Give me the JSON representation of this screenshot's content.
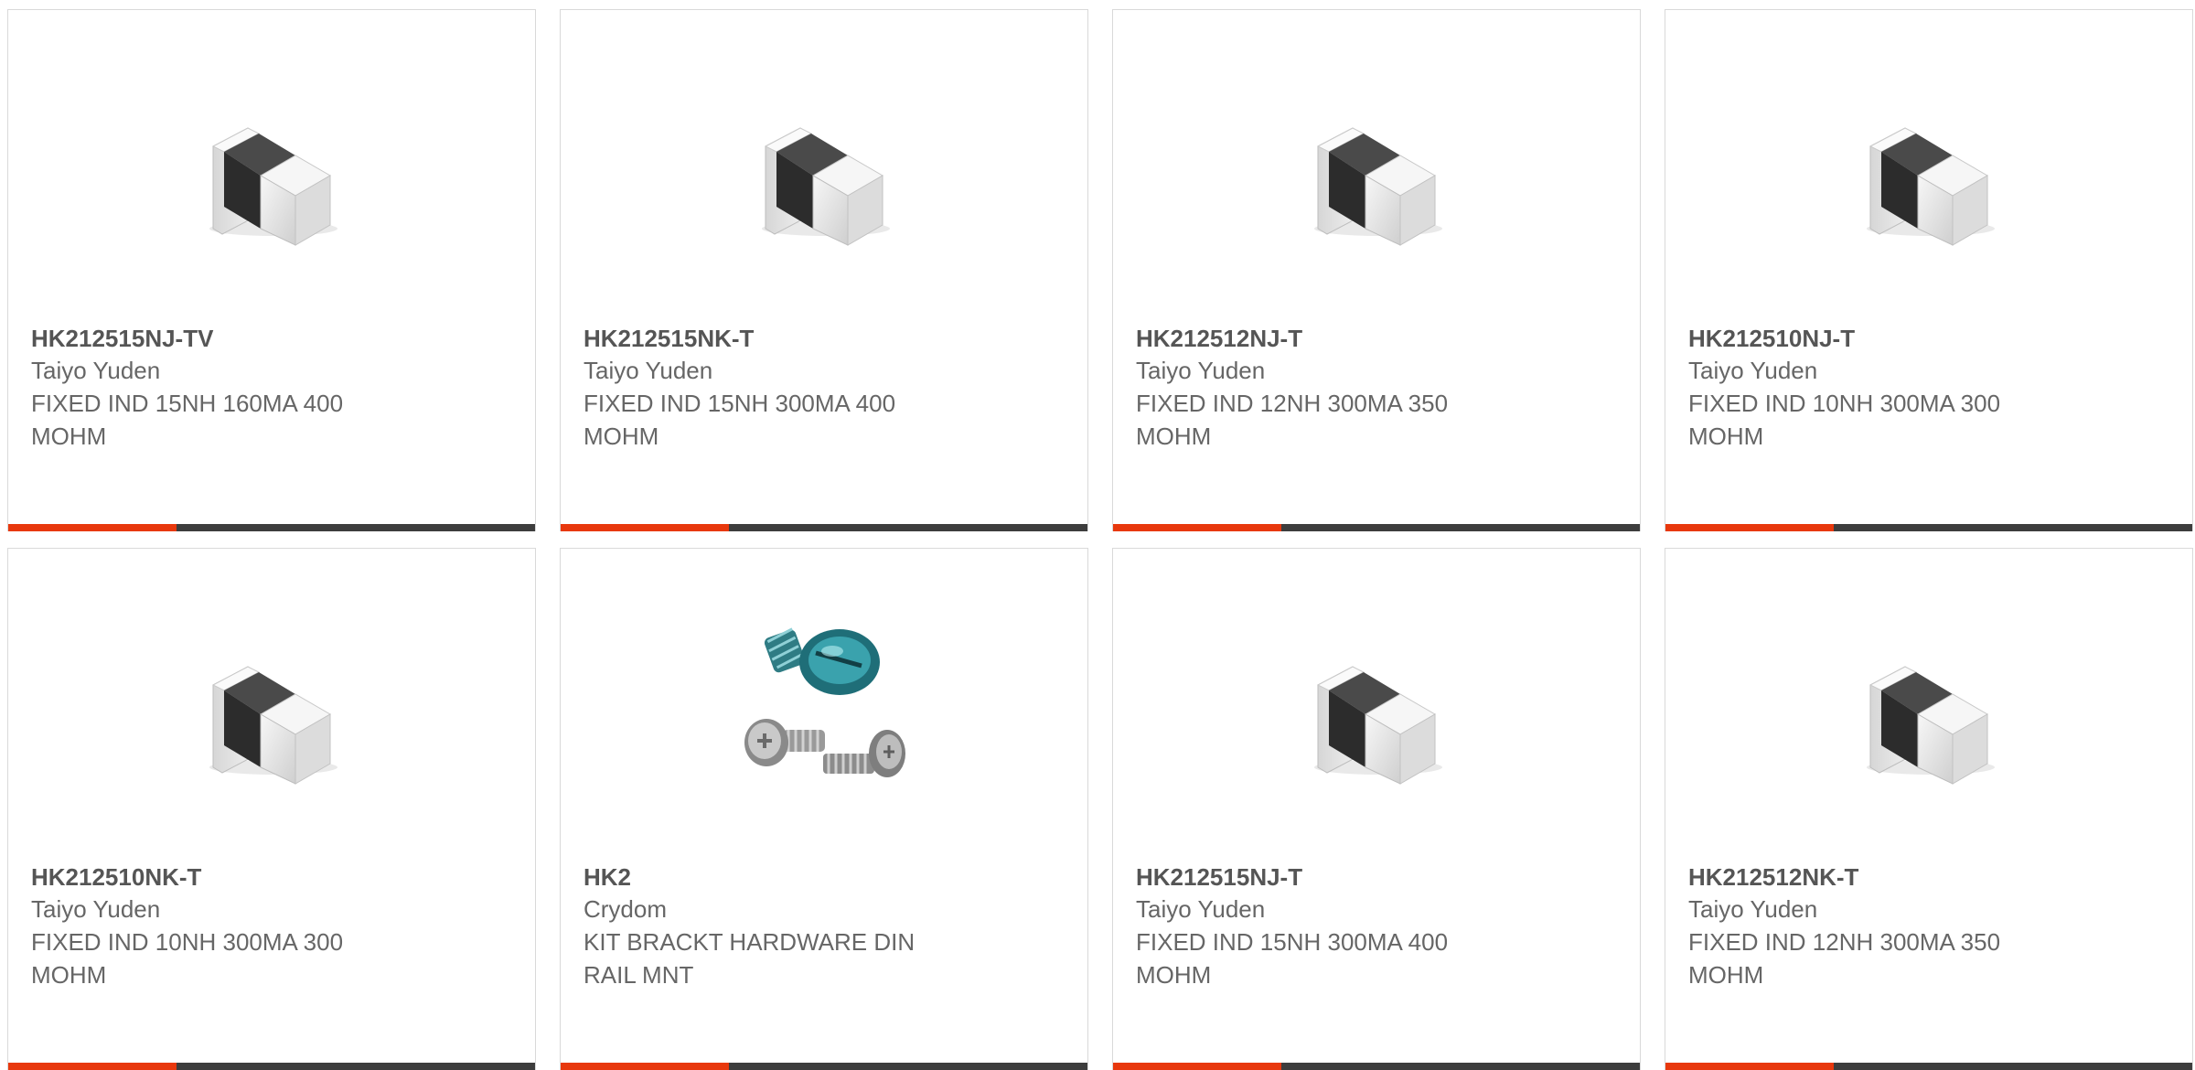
{
  "accent_color": "#e8380d",
  "bar_color": "#3d3d3d",
  "products": [
    {
      "part": "HK212515NJ-TV",
      "manufacturer": "Taiyo Yuden",
      "description": "FIXED IND 15NH 160MA 400 MOHM",
      "image": "smd-inductor-chip",
      "bar_progress": 0.32
    },
    {
      "part": "HK212515NK-T",
      "manufacturer": "Taiyo Yuden",
      "description": "FIXED IND 15NH 300MA 400 MOHM",
      "image": "smd-inductor-chip",
      "bar_progress": 0.32
    },
    {
      "part": "HK212512NJ-T",
      "manufacturer": "Taiyo Yuden",
      "description": "FIXED IND 12NH 300MA 350 MOHM",
      "image": "smd-inductor-chip",
      "bar_progress": 0.32
    },
    {
      "part": "HK212510NJ-T",
      "manufacturer": "Taiyo Yuden",
      "description": "FIXED IND 10NH 300MA 300 MOHM",
      "image": "smd-inductor-chip",
      "bar_progress": 0.32
    },
    {
      "part": "HK212510NK-T",
      "manufacturer": "Taiyo Yuden",
      "description": "FIXED IND 10NH 300MA 300 MOHM",
      "image": "smd-inductor-chip",
      "bar_progress": 0.32
    },
    {
      "part": "HK2",
      "manufacturer": "Crydom",
      "description": "KIT BRACKT HARDWARE DIN RAIL MNT",
      "image": "screw-hardware-kit",
      "bar_progress": 0.32
    },
    {
      "part": "HK212515NJ-T",
      "manufacturer": "Taiyo Yuden",
      "description": "FIXED IND 15NH 300MA 400 MOHM",
      "image": "smd-inductor-chip",
      "bar_progress": 0.32
    },
    {
      "part": "HK212512NK-T",
      "manufacturer": "Taiyo Yuden",
      "description": "FIXED IND 12NH 300MA 350 MOHM",
      "image": "smd-inductor-chip",
      "bar_progress": 0.32
    }
  ]
}
